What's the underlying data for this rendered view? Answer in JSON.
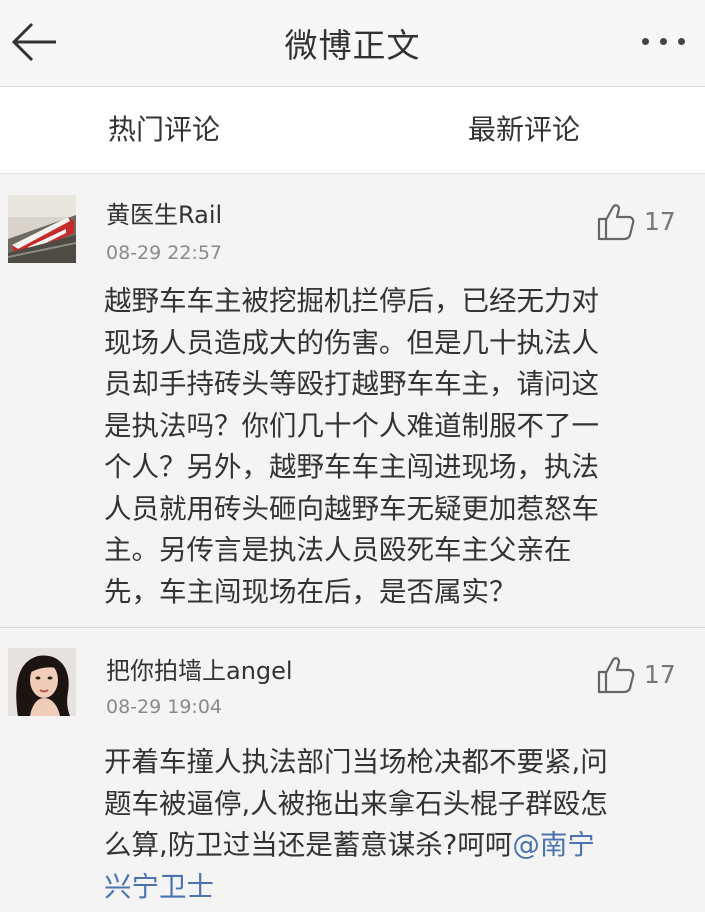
{
  "header": {
    "title": "微博正文",
    "back_icon": "arrow-left-icon",
    "more_icon": "more-horizontal-icon"
  },
  "tabs": [
    {
      "label": "热门评论",
      "active": true
    },
    {
      "label": "最新评论",
      "active": false
    }
  ],
  "comments": [
    {
      "username": "黄医生Rail",
      "time": "08-29 22:57",
      "likes": "17",
      "avatar": "high-speed-train-photo",
      "text": "越野车车主被挖掘机拦停后，已经无力对\n现场人员造成大的伤害。但是几十执法人\n员却手持砖头等殴打越野车车主，请问这\n是执法吗？你们几十个人难道制服不了一\n个人？另外，越野车车主闯进现场，执法\n人员就用砖头砸向越野车无疑更加惹怒车\n主。另传言是执法人员殴死车主父亲在\n先，车主闯现场在后，是否属实？"
    },
    {
      "username": "把你拍墙上angel",
      "time": "08-29 19:04",
      "likes": "17",
      "avatar": "woman-portrait-photo",
      "text": "开着车撞人执法部门当场枪决都不要紧,问\n题车被逼停,人被拖出来拿石头棍子群殴怎\n么算,防卫过当还是蓄意谋杀?呵呵",
      "mention": "@南宁\n兴宁卫士"
    }
  ],
  "colors": {
    "mention": "#4a73b0",
    "background": "#f4f4f4",
    "meta_text": "#8a8a8a"
  }
}
